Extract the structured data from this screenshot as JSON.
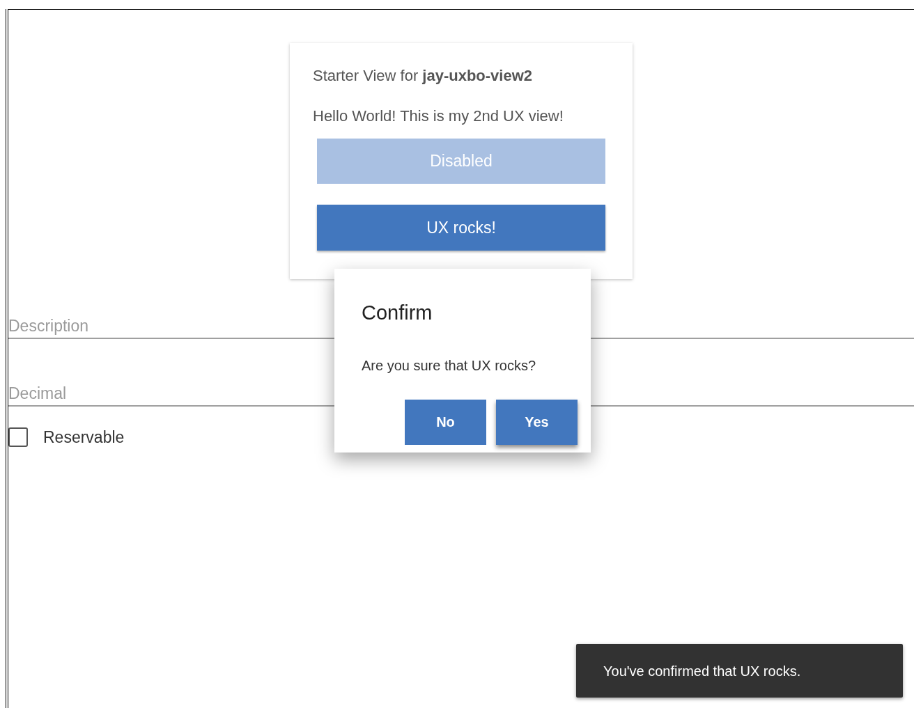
{
  "card": {
    "title": "Starter View for **jay-uxbo-view2**",
    "message": "Hello World! This is my 2nd UX view!",
    "buttons": [
      {
        "label": "Disabled",
        "disabled": true
      },
      {
        "label": "UX rocks!",
        "disabled": false
      }
    ]
  },
  "fields": [
    {
      "placeholder": "Description"
    },
    {
      "placeholder": "Decimal"
    }
  ],
  "checkbox": {
    "label": "Reservable",
    "checked": false
  },
  "dialog": {
    "title": "Confirm",
    "message": "Are you sure that UX rocks?",
    "buttons": [
      {
        "label": "No",
        "focused": false
      },
      {
        "label": "Yes",
        "focused": true
      }
    ]
  },
  "toast": {
    "message": "You've confirmed that UX rocks."
  }
}
